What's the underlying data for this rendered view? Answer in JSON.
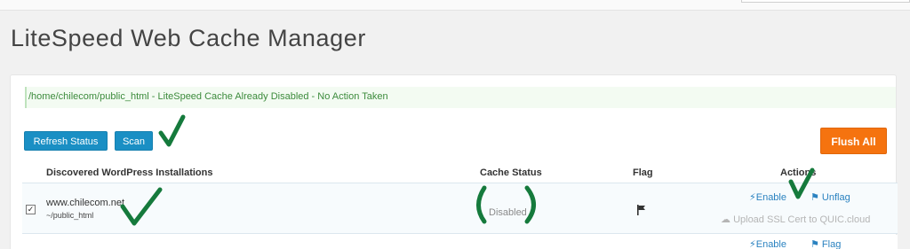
{
  "page": {
    "title": "LiteSpeed Web Cache Manager"
  },
  "notice": {
    "text": "/home/chilecom/public_html - LiteSpeed Cache Already Disabled - No Action Taken"
  },
  "toolbar": {
    "refresh_label": "Refresh Status",
    "scan_label": "Scan",
    "flush_label": "Flush All"
  },
  "table": {
    "headers": {
      "installations": "Discovered WordPress Installations",
      "cache_status": "Cache Status",
      "flag": "Flag",
      "actions": "Actions"
    },
    "rows": [
      {
        "checked": true,
        "domain": "www.chilecom.net",
        "path": "~/public_html",
        "cache_status": "Disabled",
        "flag_icon": "flag-icon",
        "actions": {
          "enable": "Enable",
          "unflag": "Unflag",
          "upload": "Upload SSL Cert to QUIC.cloud"
        }
      },
      {
        "actions": {
          "enable": "Enable",
          "flag": "Flag"
        }
      }
    ]
  },
  "annotations": {
    "mark_color": "#157a3c"
  },
  "colors": {
    "primary": "#1a8fc4",
    "flush": "#f5730f",
    "notice_text": "#3c8b3c",
    "link": "#2a82c0"
  }
}
